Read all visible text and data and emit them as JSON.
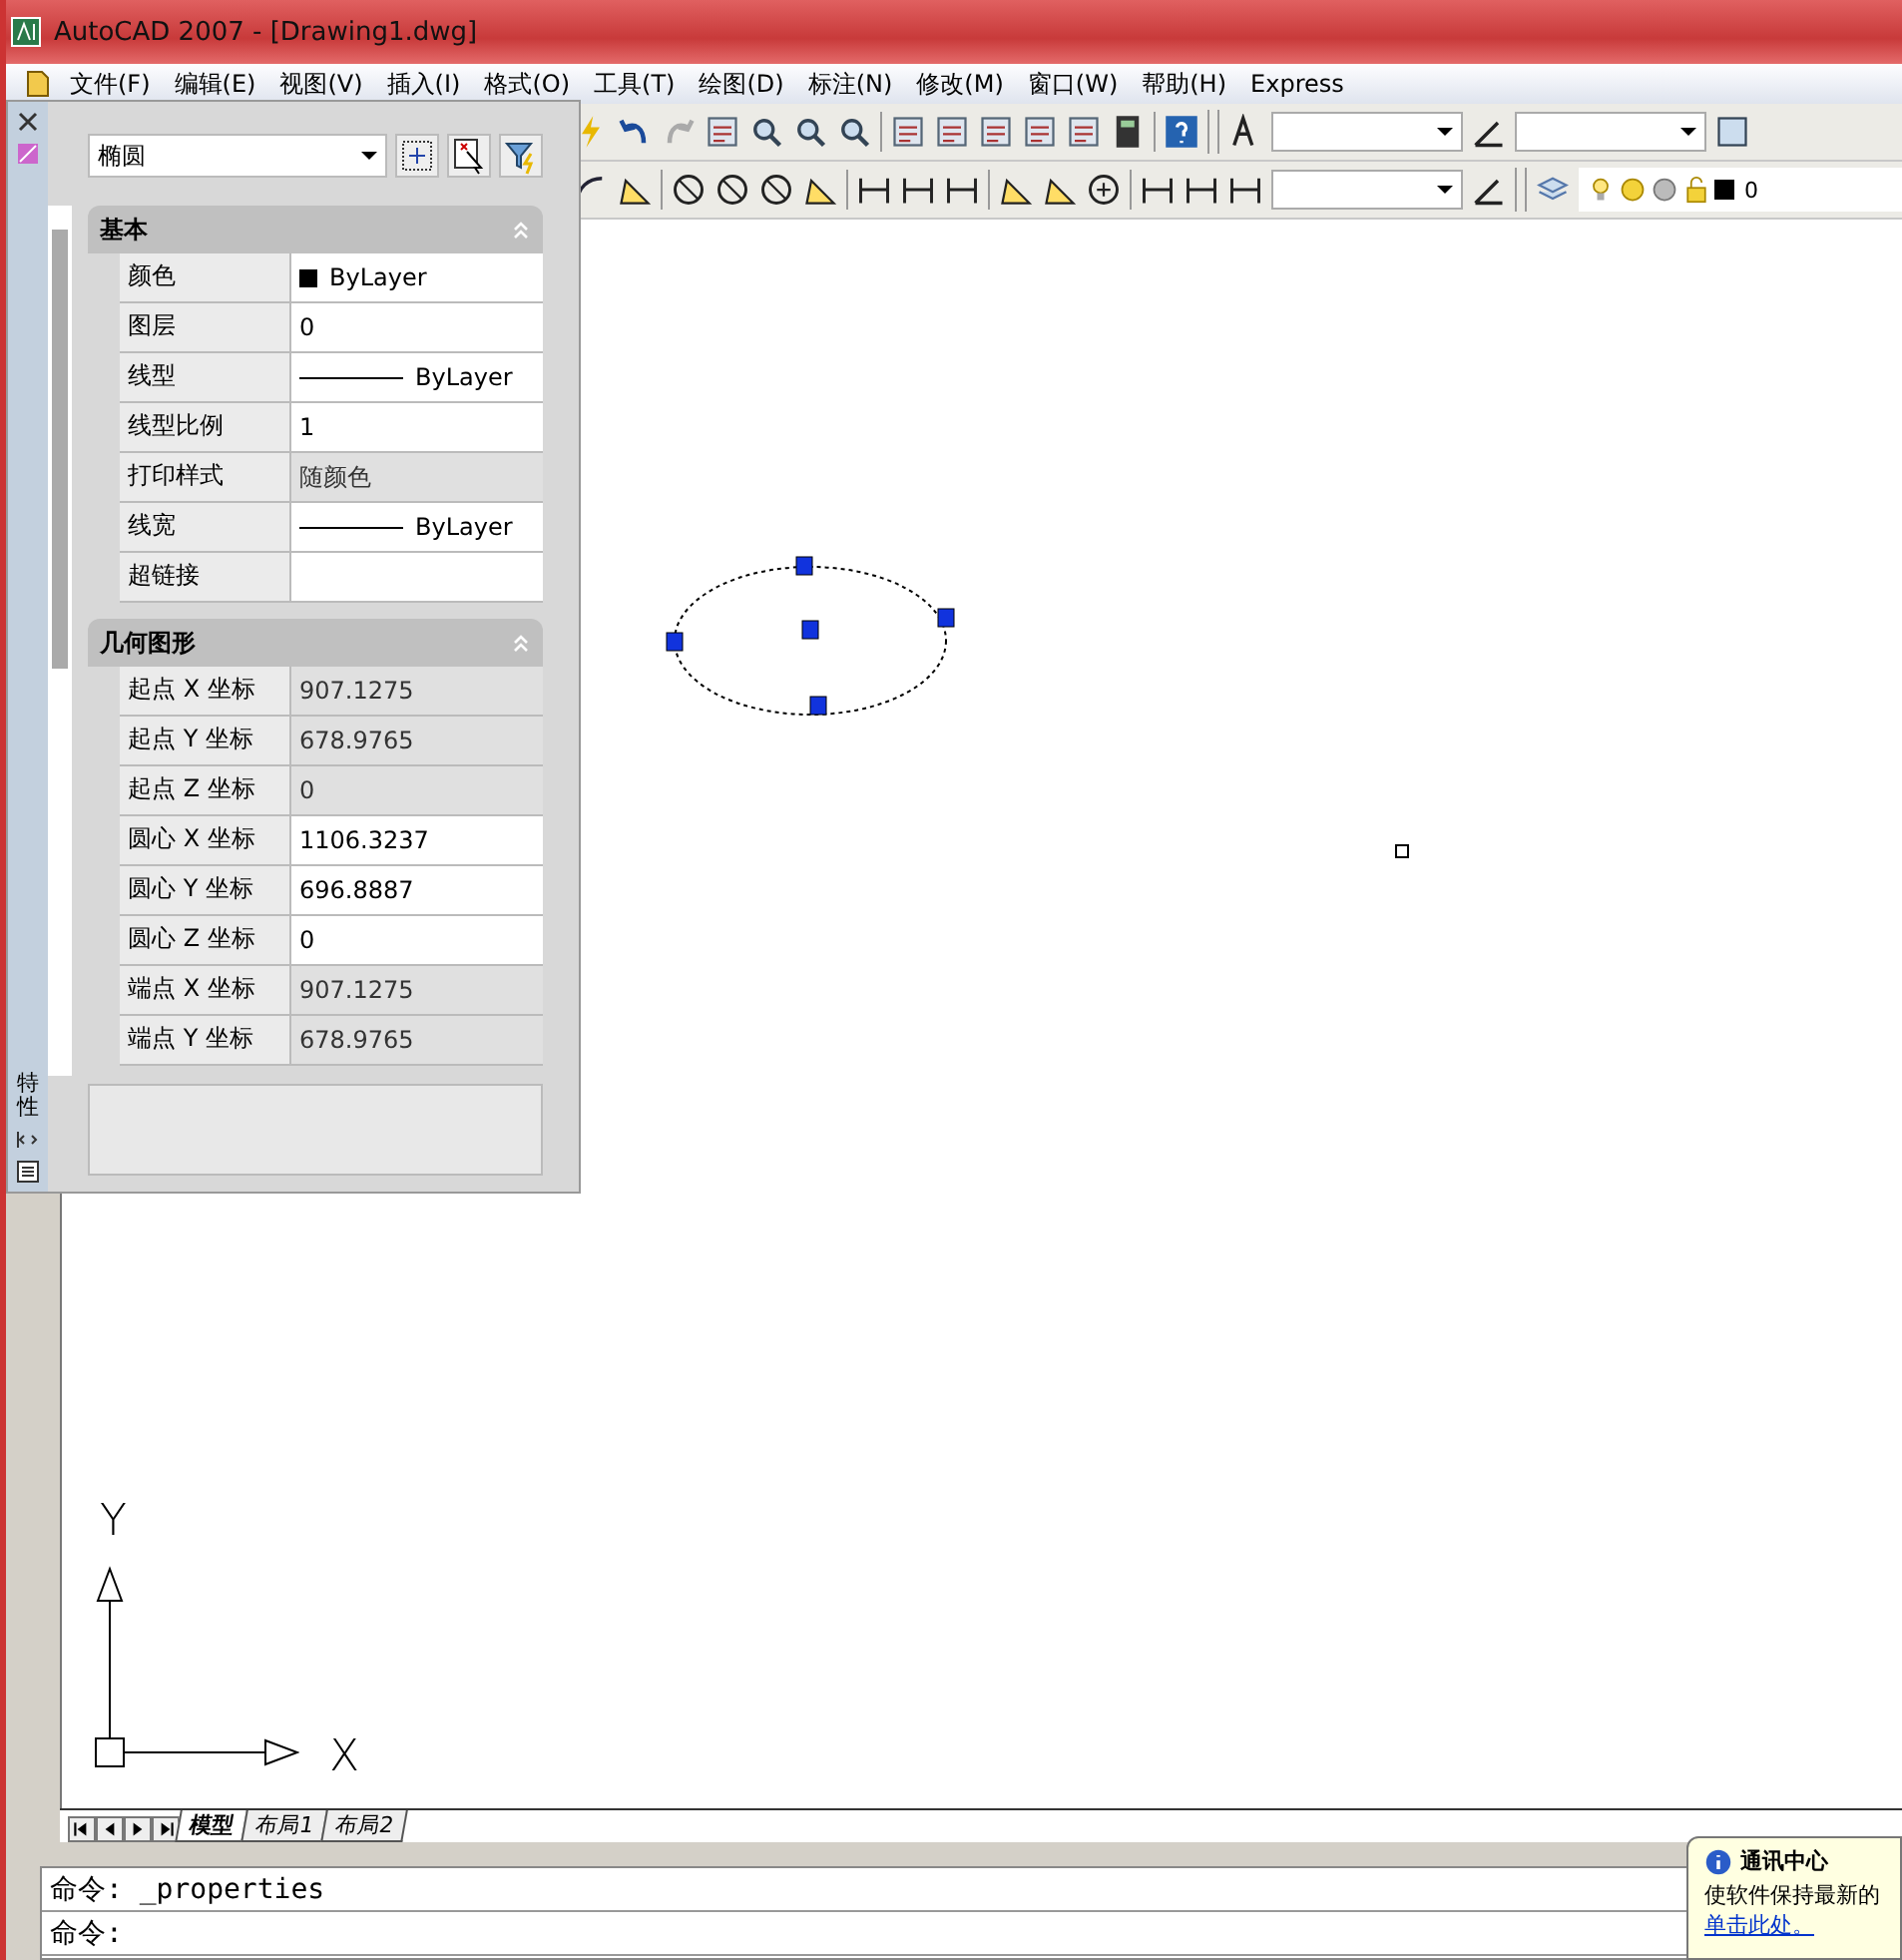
{
  "window": {
    "title": "AutoCAD 2007 - [Drawing1.dwg]"
  },
  "menu": [
    {
      "label": "文件(F)"
    },
    {
      "label": "编辑(E)"
    },
    {
      "label": "视图(V)"
    },
    {
      "label": "插入(I)"
    },
    {
      "label": "格式(O)"
    },
    {
      "label": "工具(T)"
    },
    {
      "label": "绘图(D)"
    },
    {
      "label": "标注(N)"
    },
    {
      "label": "修改(M)"
    },
    {
      "label": "窗口(W)"
    },
    {
      "label": "帮助(H)"
    },
    {
      "label": "Express"
    }
  ],
  "toolbar": {
    "layer": "0"
  },
  "properties_palette": {
    "title": "特性",
    "object_type": "椭圆",
    "sections": [
      {
        "title": "基本",
        "expanded": true,
        "rows": [
          {
            "label": "颜色",
            "value": "ByLayer",
            "kind": "color",
            "readonly": false
          },
          {
            "label": "图层",
            "value": "0",
            "kind": "text",
            "readonly": false
          },
          {
            "label": "线型",
            "value": "ByLayer",
            "kind": "line",
            "readonly": false
          },
          {
            "label": "线型比例",
            "value": "1",
            "kind": "text",
            "readonly": false
          },
          {
            "label": "打印样式",
            "value": "随颜色",
            "kind": "text",
            "readonly": true
          },
          {
            "label": "线宽",
            "value": "ByLayer",
            "kind": "line",
            "readonly": false
          },
          {
            "label": "超链接",
            "kind": "text",
            "readonly": false
          }
        ]
      },
      {
        "title": "几何图形",
        "expanded": true,
        "rows": [
          {
            "label": "起点 X 坐标",
            "value": "907.1275",
            "kind": "text",
            "readonly": true
          },
          {
            "label": "起点 Y 坐标",
            "value": "678.9765",
            "kind": "text",
            "readonly": true
          },
          {
            "label": "起点 Z 坐标",
            "value": "0",
            "kind": "text",
            "readonly": true
          },
          {
            "label": "圆心 X 坐标",
            "value": "1106.3237",
            "kind": "text",
            "readonly": false
          },
          {
            "label": "圆心 Y 坐标",
            "value": "696.8887",
            "kind": "text",
            "readonly": false
          },
          {
            "label": "圆心 Z 坐标",
            "value": "0",
            "kind": "text",
            "readonly": false
          },
          {
            "label": "端点 X 坐标",
            "value": "907.1275",
            "kind": "text",
            "readonly": true
          },
          {
            "label": "端点 Y 坐标",
            "value": "678.9765",
            "kind": "text",
            "readonly": true
          }
        ]
      }
    ]
  },
  "canvas": {
    "ellipse_selected": true,
    "ucs_y": "Y",
    "ucs_x": "X"
  },
  "layout_tabs": [
    {
      "label": "模型",
      "selected": true
    },
    {
      "label": "布局1",
      "selected": false
    },
    {
      "label": "布局2",
      "selected": false
    }
  ],
  "command_lines": [
    "命令: _properties",
    "命令:"
  ],
  "notification": {
    "title": "通讯中心",
    "text": "使软件保持最新的",
    "link": "单击此处。"
  }
}
